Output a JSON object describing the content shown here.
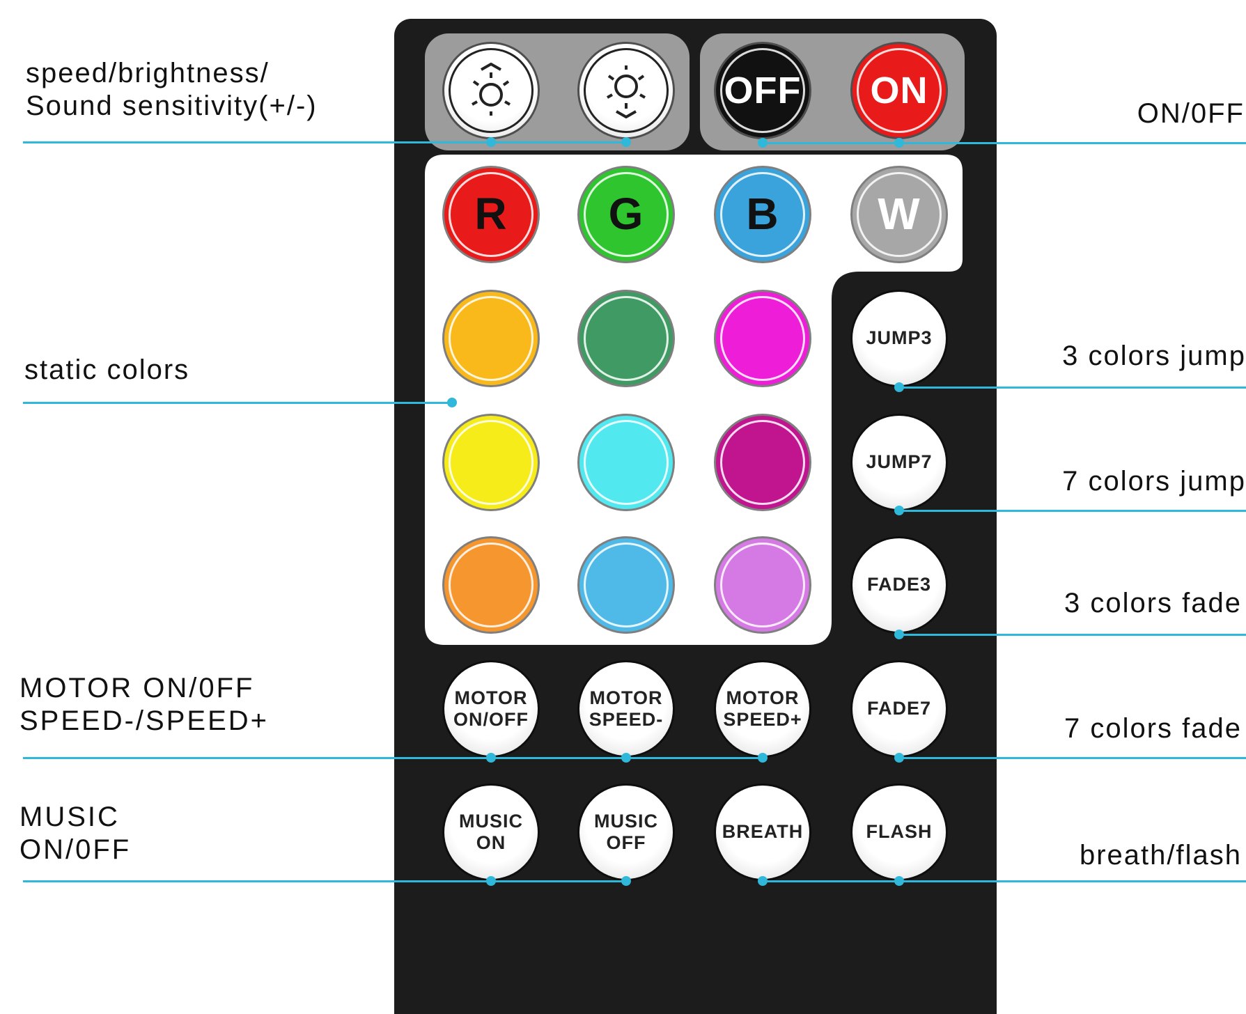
{
  "labels": {
    "speed": "speed/brightness/\nSound sensitivity(+/-)",
    "onoff": "ON/0FF",
    "static": "static colors",
    "jump3": "3 colors jump",
    "jump7": "7 colors jump",
    "fade3": "3 colors fade",
    "fade7": "7 colors fade",
    "motor": "MOTOR  ON/0FF\nSPEED-/SPEED+",
    "music": "MUSIC\nON/0FF",
    "breathflash": "breath/flash"
  },
  "buttons": {
    "off": "OFF",
    "on": "ON",
    "r": "R",
    "g": "G",
    "b": "B",
    "w": "W",
    "jump3": "JUMP3",
    "jump7": "JUMP7",
    "fade3": "FADE3",
    "fade7": "FADE7",
    "motor_onoff": "MOTOR\nON/OFF",
    "motor_speed_minus": "MOTOR\nSPEED-",
    "motor_speed_plus": "MOTOR\nSPEED+",
    "music_on": "MUSIC\nON",
    "music_off": "MUSIC\nOFF",
    "breath": "BREATH",
    "flash": "FLASH"
  },
  "static_colors": [
    "#f9b91a",
    "#3f9a63",
    "#ee1ed8",
    "#f5ec19",
    "#52e8ef",
    "#c0158f",
    "#f6962e",
    "#4fb9e8",
    "#d57ae4"
  ],
  "colors": {
    "accent_line": "#2fb8d9",
    "remote_body": "#1c1c1c",
    "red": "#e81a1a",
    "green": "#2fc52f",
    "blue": "#3ba3dc",
    "white_btn": "#a7a7a7"
  }
}
